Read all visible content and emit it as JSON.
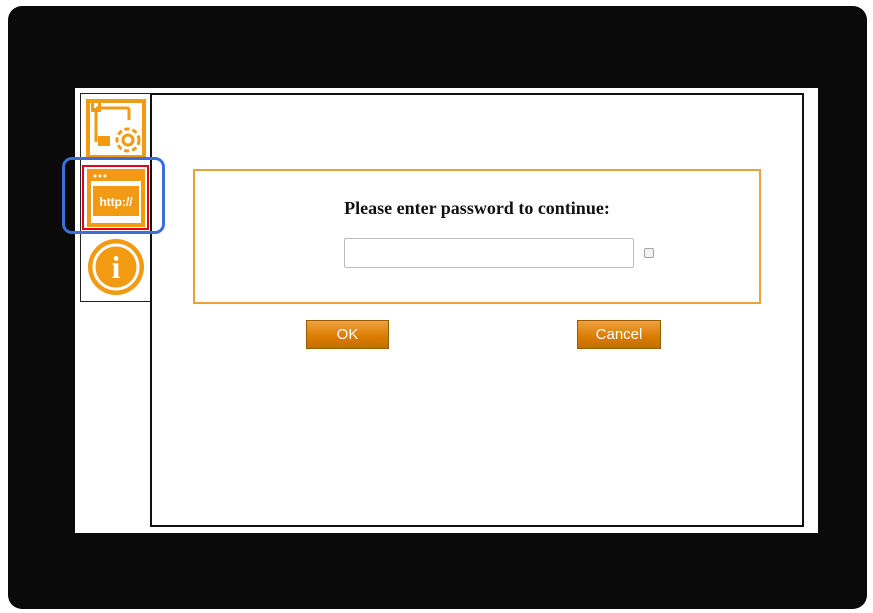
{
  "dialog": {
    "prompt": "Please enter password to continue:",
    "password_value": "",
    "password_placeholder": ""
  },
  "buttons": {
    "ok_label": "OK",
    "cancel_label": "Cancel"
  },
  "sidebar": {
    "items": [
      {
        "name": "network-settings",
        "icon": "network-gear-icon"
      },
      {
        "name": "web-http",
        "icon": "browser-http-icon",
        "label": "http://",
        "selected": true
      },
      {
        "name": "info",
        "icon": "info-icon",
        "label": "i"
      }
    ]
  },
  "colors": {
    "accent": "#f29a12",
    "box_border": "#e8a23a",
    "selected_border": "#e3001b",
    "highlight": "#3b70d6",
    "bezel": "#0a0a0a"
  }
}
